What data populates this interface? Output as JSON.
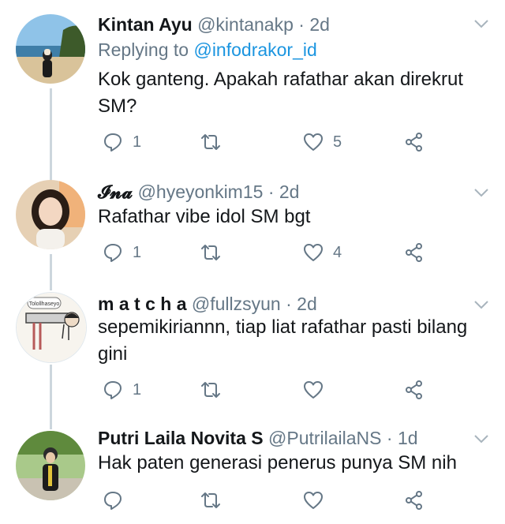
{
  "tweets": [
    {
      "name": "Kintan Ayu",
      "handle": "@kintanakp",
      "dot": "·",
      "time": "2d",
      "reply_prefix": "Replying to",
      "reply_mention": "@infodrakor_id",
      "text_line1": "Kok ganteng. Apakah rafathar akan direkrut",
      "text_line2": "SM?",
      "reply_count": "1",
      "like_count": "5"
    },
    {
      "name": "𝓘𝓷𝓪",
      "handle": "@hyeyonkim15",
      "dot": "·",
      "time": "2d",
      "text_line1": "Rafathar vibe idol SM bgt",
      "reply_count": "1",
      "like_count": "4"
    },
    {
      "name": "m a t c h a",
      "handle": "@fullzsyun",
      "dot": "·",
      "time": "2d",
      "avatar_label": "Tolollhaseyo",
      "text_line1": "sepemikiriannn, tiap liat rafathar pasti bilang",
      "text_line2": "gini",
      "reply_count": "1"
    },
    {
      "name": "Putri Laila Novita S",
      "handle": "@PutrilailaNS",
      "dot": "·",
      "time": "1d",
      "text_line1": "Hak paten generasi penerus punya SM nih"
    }
  ],
  "icons": {
    "reply": "reply-icon",
    "retweet": "retweet-icon",
    "like": "heart-icon",
    "share": "share-icon",
    "more": "chevron-down-icon"
  },
  "colors": {
    "text": "#14171a",
    "muted": "#657786",
    "link": "#1b95e0",
    "thread_line": "#ccd6dd"
  }
}
